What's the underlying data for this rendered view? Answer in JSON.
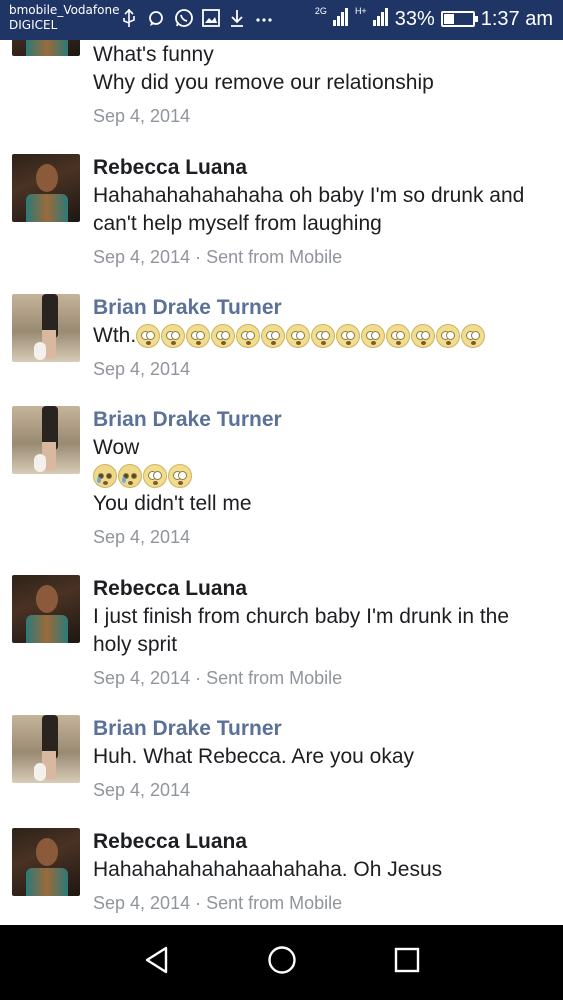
{
  "status_bar": {
    "carrier_line1": "bmobile_Vodafone",
    "carrier_line2": "DIGICEL",
    "network_2g": "2G",
    "network_h": "H+",
    "battery_percent": "33%",
    "battery_level": 0.33,
    "time": "1:37 am",
    "icons": [
      "usb-icon",
      "chat-bubble-icon",
      "whatsapp-icon",
      "gallery-icon",
      "download-icon",
      "more-icon"
    ]
  },
  "messages": [
    {
      "name": "",
      "lines": [
        "What's funny",
        "Why did you remove our relationship"
      ],
      "meta": "Sep 4, 2014"
    },
    {
      "name": "Rebecca Luana",
      "lines": [
        "Hahahahahahahaha oh baby I'm so drunk and",
        "can't help myself from laughing"
      ],
      "meta": "Sep 4, 2014 · Sent from Mobile"
    },
    {
      "name": "Brian Drake Turner",
      "lines": [
        "Wth."
      ],
      "meta": "Sep 4, 2014"
    },
    {
      "name": "Brian Drake Turner",
      "lines": [
        "Wow",
        "You didn't tell me"
      ],
      "meta": "Sep 4, 2014"
    },
    {
      "name": "Rebecca Luana",
      "lines": [
        "I just finish from church baby I'm drunk in the",
        "holy sprit"
      ],
      "meta": "Sep 4, 2014 · Sent from Mobile"
    },
    {
      "name": "Brian Drake Turner",
      "lines": [
        "Huh. What Rebecca. Are you okay"
      ],
      "meta": "Sep 4, 2014"
    },
    {
      "name": "Rebecca Luana",
      "lines": [
        "Hahahahahahahaahahaha. Oh Jesus"
      ],
      "meta": "Sep 4, 2014 · Sent from Mobile"
    }
  ],
  "emoji": {
    "wth_count": 14,
    "wow_cry_count": 2,
    "wow_flushed_count": 2
  },
  "nav": {
    "icons": [
      "back-icon",
      "home-icon",
      "recents-icon"
    ]
  }
}
